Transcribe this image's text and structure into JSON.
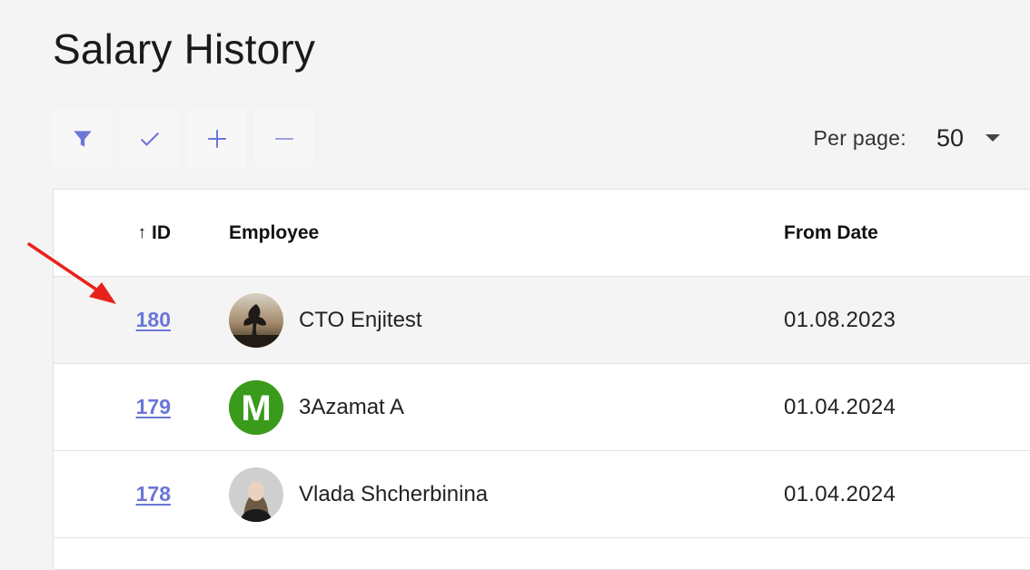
{
  "page": {
    "title": "Salary History"
  },
  "toolbar": {
    "buttons": [
      {
        "name": "filter",
        "icon": "filter-icon"
      },
      {
        "name": "select",
        "icon": "check-icon"
      },
      {
        "name": "expand",
        "icon": "plus-icon"
      },
      {
        "name": "collapse",
        "icon": "minus-icon"
      }
    ],
    "accent_color": "#6b76d6"
  },
  "pagination": {
    "per_page_label": "Per page:",
    "per_page_value": "50"
  },
  "table": {
    "columns": {
      "id": "ID",
      "employee": "Employee",
      "from_date": "From Date"
    },
    "sort_indicator": "↑",
    "rows": [
      {
        "id": "180",
        "employee": "CTO Enjitest",
        "from_date": "01.08.2023",
        "avatar": "photo-avatar"
      },
      {
        "id": "179",
        "employee": "3Azamat A",
        "from_date": "01.04.2024",
        "avatar": "letter-avatar",
        "avatar_letter": "M",
        "avatar_color": "#3a9a1c"
      },
      {
        "id": "178",
        "employee": "Vlada Shcherbinina",
        "from_date": "01.04.2024",
        "avatar": "photo-avatar"
      }
    ]
  },
  "annotation": {
    "color": "#e8231d",
    "icon": "red-arrow"
  }
}
